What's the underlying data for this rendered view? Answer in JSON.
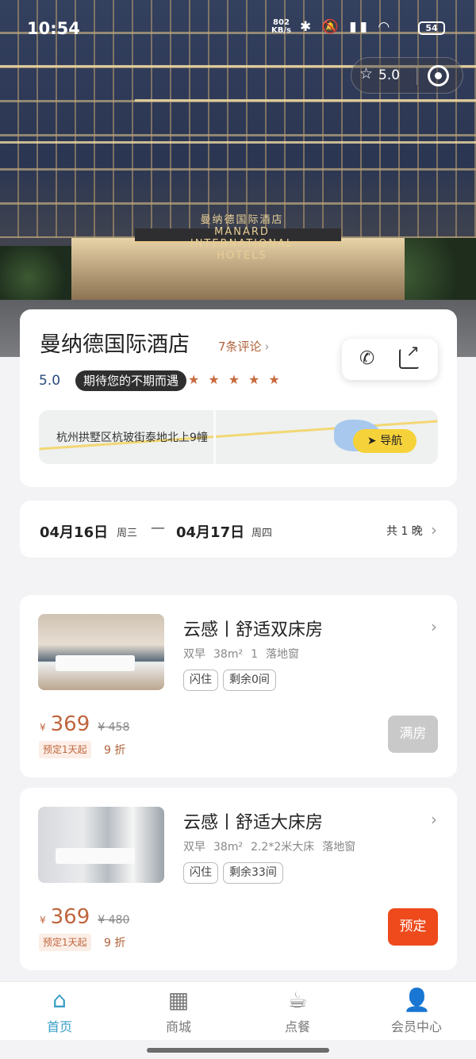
{
  "status_bar": {
    "time": "10:54",
    "net_speed": "802\nKB/s",
    "battery": "54"
  },
  "header": {
    "rating": "5.0"
  },
  "hotel": {
    "name": "曼纳德国际酒店",
    "reviews": "7条评论",
    "score": "5.0",
    "slogan": "期待您的不期而遇",
    "stars": "★★★★★",
    "sign_text": "曼纳德国际酒店 MANARD INTERNATIONAL HOTELS",
    "address": "杭州拱墅区杭玻街泰地北上9幢",
    "nav_label": "导航"
  },
  "dates": {
    "checkin": "04月16日",
    "checkin_weekday": "周三",
    "separator": "—",
    "checkout": "04月17日",
    "checkout_weekday": "周四",
    "nights": "共 1 晚"
  },
  "rooms": [
    {
      "name": "云感丨舒适双床房",
      "breakfast": "双早",
      "area": "38m²",
      "bed": "1",
      "window": "落地窗",
      "tags": [
        "闪住",
        "剩余0间"
      ],
      "currency": "¥",
      "price": "369",
      "original_price": "¥ 458",
      "min_stay": "预定1天起",
      "discount": "9 折",
      "button": "满房"
    },
    {
      "name": "云感丨舒适大床房",
      "breakfast": "双早",
      "area": "38m²",
      "bed": "2.2*2米大床",
      "window": "落地窗",
      "tags": [
        "闪住",
        "剩余33间"
      ],
      "currency": "¥",
      "price": "369",
      "original_price": "¥ 480",
      "min_stay": "预定1天起",
      "discount": "9 折",
      "button": "预定"
    }
  ],
  "tabbar": [
    {
      "label": "首页",
      "icon": "home-icon",
      "active": true
    },
    {
      "label": "商城",
      "icon": "store-icon",
      "active": false
    },
    {
      "label": "点餐",
      "icon": "cup-icon",
      "active": false
    },
    {
      "label": "会员中心",
      "icon": "user-icon",
      "active": false
    }
  ],
  "colors": {
    "accent": "#c0653d",
    "book_button": "#ee4a1c",
    "active_tab": "#3a9fc6",
    "nav_button": "#f6d23a"
  }
}
